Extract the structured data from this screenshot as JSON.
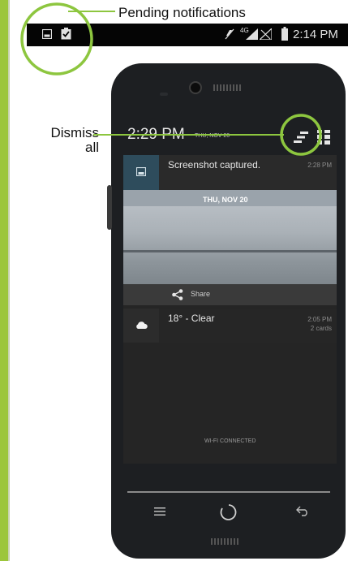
{
  "callouts": {
    "pending": "Pending notifications",
    "dismiss_line1": "Dismiss",
    "dismiss_line2": "all"
  },
  "status_bar": {
    "network": "4G",
    "time": "2:14 PM",
    "icons": [
      "image-icon",
      "clipboard-check-icon",
      "mute-icon",
      "signal-icon",
      "battery-icon"
    ]
  },
  "phone": {
    "header_time": "2:29 PM",
    "header_date": "THU, NOV 20",
    "notifications": [
      {
        "title": "Screenshot captured.",
        "time": "2:28 PM",
        "icon": "image-icon"
      },
      {
        "title": "18° - Clear",
        "time": "2:05 PM",
        "sub": "2 cards",
        "icon": "cloud-icon"
      }
    ],
    "screenshot_preview_date": "THU, NOV 20",
    "share_label": "Share",
    "wifi_status": "WI-FI CONNECTED",
    "nav": [
      "menu-icon",
      "home-icon",
      "back-icon"
    ]
  },
  "colors": {
    "accent": "#9cc63b",
    "callout_circle": "#8dc63f",
    "screen_bg": "#262626",
    "notif_icon_bg": "#2e4c5c"
  }
}
